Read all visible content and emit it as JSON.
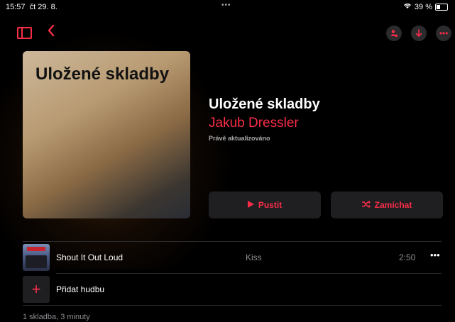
{
  "status_bar": {
    "time": "15:57",
    "date": "čt 29. 8.",
    "battery": "39 %"
  },
  "toolbar": {
    "back_icon": "chevron-left-icon",
    "sidebar_icon": "sidebar-icon",
    "share_icon": "person-badge-icon",
    "download_icon": "download-icon",
    "more_icon": "ellipsis-icon"
  },
  "artwork": {
    "title": "Uložené skladby"
  },
  "playlist": {
    "title": "Uložené skladby",
    "owner": "Jakub Dressler",
    "updated": "Právě aktualizováno"
  },
  "actions": {
    "play": "Pustit",
    "shuffle": "Zamíchat"
  },
  "tracks": [
    {
      "title": "Shout It Out Loud",
      "artist": "Kiss",
      "duration": "2:50"
    }
  ],
  "add_music": "Přidat hudbu",
  "summary": "1 skladba, 3 minuty",
  "colors": {
    "accent": "#fa2d48",
    "background": "#000000"
  }
}
